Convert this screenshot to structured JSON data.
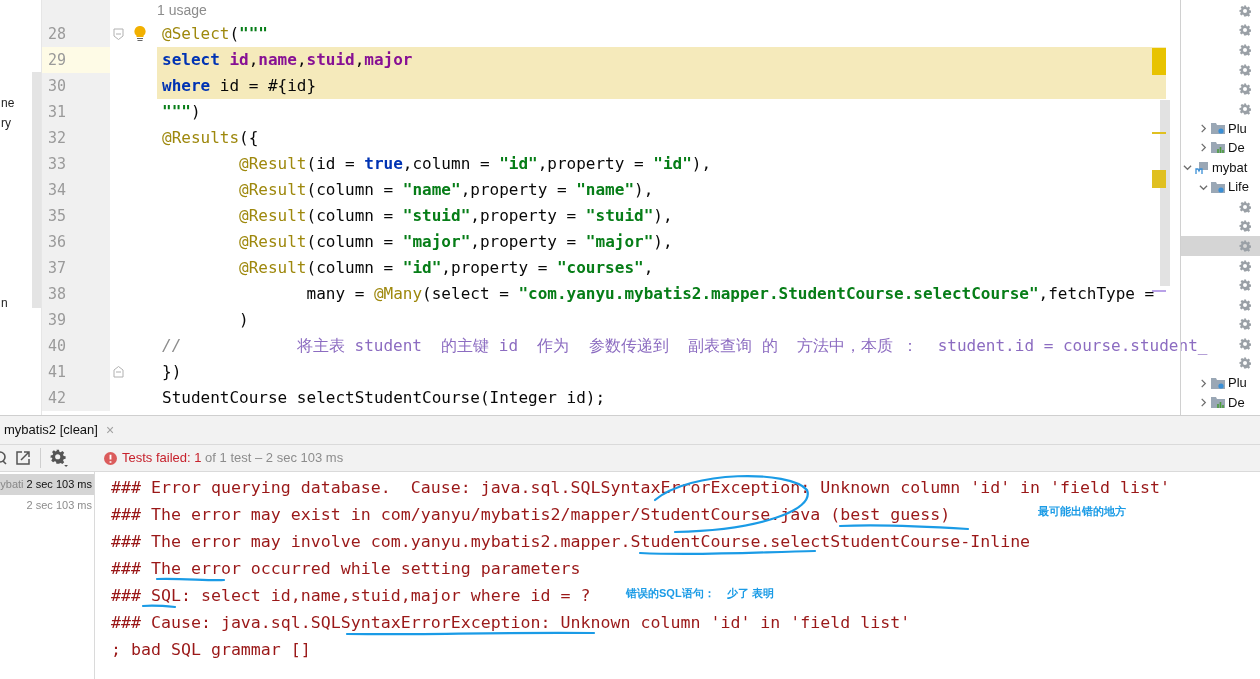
{
  "side_fragments": [
    {
      "text": "ne"
    },
    {
      "text": "ry"
    },
    {
      "text": "n"
    }
  ],
  "usage_hint": "1 usage",
  "code_lines": [
    {
      "number": "28",
      "highlighted": false,
      "current": false,
      "fold_start": true,
      "fold_end": false,
      "bulb": true,
      "tokens": [
        {
          "kind": "ann",
          "text": "@Select"
        },
        {
          "kind": "plain",
          "text": "("
        },
        {
          "kind": "str",
          "text": "\"\"\""
        }
      ]
    },
    {
      "number": "29",
      "highlighted": true,
      "current": true,
      "fold_start": false,
      "fold_end": false,
      "bulb": false,
      "tokens": [
        {
          "kind": "kw",
          "text": "select "
        },
        {
          "kind": "field",
          "text": "id"
        },
        {
          "kind": "plain",
          "text": ","
        },
        {
          "kind": "field",
          "text": "name"
        },
        {
          "kind": "plain",
          "text": ","
        },
        {
          "kind": "field",
          "text": "stuid"
        },
        {
          "kind": "plain",
          "text": ","
        },
        {
          "kind": "field",
          "text": "major"
        }
      ]
    },
    {
      "number": "30",
      "highlighted": true,
      "current": false,
      "fold_start": false,
      "fold_end": false,
      "bulb": false,
      "tokens": [
        {
          "kind": "kw",
          "text": "where"
        },
        {
          "kind": "plain",
          "text": " id = #{id}"
        }
      ]
    },
    {
      "number": "31",
      "highlighted": false,
      "current": false,
      "fold_start": false,
      "fold_end": false,
      "bulb": false,
      "tokens": [
        {
          "kind": "str",
          "text": "\"\"\""
        },
        {
          "kind": "plain",
          "text": ")"
        }
      ]
    },
    {
      "number": "32",
      "highlighted": false,
      "current": false,
      "fold_start": false,
      "fold_end": false,
      "bulb": false,
      "tokens": [
        {
          "kind": "ann",
          "text": "@Results"
        },
        {
          "kind": "plain",
          "text": "({"
        }
      ]
    },
    {
      "number": "33",
      "highlighted": false,
      "current": false,
      "fold_start": false,
      "fold_end": false,
      "bulb": false,
      "tokens": [
        {
          "kind": "ann",
          "text": "        @Result"
        },
        {
          "kind": "plain",
          "text": "(id = "
        },
        {
          "kind": "kw",
          "text": "true"
        },
        {
          "kind": "plain",
          "text": ",column = "
        },
        {
          "kind": "str",
          "text": "\"id\""
        },
        {
          "kind": "plain",
          "text": ",property = "
        },
        {
          "kind": "str",
          "text": "\"id\""
        },
        {
          "kind": "plain",
          "text": "),"
        }
      ]
    },
    {
      "number": "34",
      "highlighted": false,
      "current": false,
      "fold_start": false,
      "fold_end": false,
      "bulb": false,
      "tokens": [
        {
          "kind": "ann",
          "text": "        @Result"
        },
        {
          "kind": "plain",
          "text": "(column = "
        },
        {
          "kind": "str",
          "text": "\"name\""
        },
        {
          "kind": "plain",
          "text": ",property = "
        },
        {
          "kind": "str",
          "text": "\"name\""
        },
        {
          "kind": "plain",
          "text": "),"
        }
      ]
    },
    {
      "number": "35",
      "highlighted": false,
      "current": false,
      "fold_start": false,
      "fold_end": false,
      "bulb": false,
      "tokens": [
        {
          "kind": "ann",
          "text": "        @Result"
        },
        {
          "kind": "plain",
          "text": "(column = "
        },
        {
          "kind": "str",
          "text": "\"stuid\""
        },
        {
          "kind": "plain",
          "text": ",property = "
        },
        {
          "kind": "str",
          "text": "\"stuid\""
        },
        {
          "kind": "plain",
          "text": "),"
        }
      ]
    },
    {
      "number": "36",
      "highlighted": false,
      "current": false,
      "fold_start": false,
      "fold_end": false,
      "bulb": false,
      "tokens": [
        {
          "kind": "ann",
          "text": "        @Result"
        },
        {
          "kind": "plain",
          "text": "(column = "
        },
        {
          "kind": "str",
          "text": "\"major\""
        },
        {
          "kind": "plain",
          "text": ",property = "
        },
        {
          "kind": "str",
          "text": "\"major\""
        },
        {
          "kind": "plain",
          "text": "),"
        }
      ]
    },
    {
      "number": "37",
      "highlighted": false,
      "current": false,
      "fold_start": false,
      "fold_end": false,
      "bulb": false,
      "tokens": [
        {
          "kind": "ann",
          "text": "        @Result"
        },
        {
          "kind": "plain",
          "text": "(column = "
        },
        {
          "kind": "str",
          "text": "\"id\""
        },
        {
          "kind": "plain",
          "text": ",property = "
        },
        {
          "kind": "str",
          "text": "\"courses\""
        },
        {
          "kind": "plain",
          "text": ","
        }
      ]
    },
    {
      "number": "38",
      "highlighted": false,
      "current": false,
      "fold_start": false,
      "fold_end": false,
      "bulb": false,
      "tokens": [
        {
          "kind": "plain",
          "text": "               many = "
        },
        {
          "kind": "ann",
          "text": "@Many"
        },
        {
          "kind": "plain",
          "text": "(select = "
        },
        {
          "kind": "str",
          "text": "\"com.yanyu.mybatis2.mapper.StudentCourse.selectCourse\""
        },
        {
          "kind": "plain",
          "text": ",fetchType ="
        }
      ]
    },
    {
      "number": "39",
      "highlighted": false,
      "current": false,
      "fold_start": false,
      "fold_end": false,
      "bulb": false,
      "tokens": [
        {
          "kind": "plain",
          "text": "        )"
        }
      ]
    },
    {
      "number": "40",
      "highlighted": false,
      "current": false,
      "fold_start": false,
      "fold_end": false,
      "bulb": false,
      "tokens": [
        {
          "kind": "comment",
          "text": "//"
        },
        {
          "kind": "comment_text",
          "text": "            将主表 student  的主键 id  作为  参数传递到  副表查询 的  方法中，本质 ：  student.id = course.student_"
        }
      ]
    },
    {
      "number": "41",
      "highlighted": false,
      "current": false,
      "fold_start": false,
      "fold_end": true,
      "bulb": false,
      "tokens": [
        {
          "kind": "plain",
          "text": "})"
        }
      ]
    },
    {
      "number": "42",
      "highlighted": false,
      "current": false,
      "fold_start": false,
      "fold_end": false,
      "bulb": false,
      "tokens": [
        {
          "kind": "plain",
          "text": "StudentCourse selectStudentCourse(Integer id);"
        }
      ]
    }
  ],
  "maven_tree": [
    {
      "kind": "hidden",
      "children": [
        {
          "kind": "hidden",
          "children": [
            {
              "kind": "goal",
              "selected": false
            },
            {
              "kind": "goal",
              "selected": false
            },
            {
              "kind": "goal",
              "selected": false
            },
            {
              "kind": "goal",
              "selected": false
            },
            {
              "kind": "goal",
              "selected": false
            },
            {
              "kind": "goal",
              "selected": false
            }
          ]
        },
        {
          "kind": "plugins",
          "label": "Plu",
          "expanded": false
        },
        {
          "kind": "deps",
          "label": "De",
          "expanded": false
        }
      ]
    },
    {
      "kind": "module",
      "label": "mybat",
      "expanded": true,
      "children": [
        {
          "kind": "plugins",
          "label": "Life",
          "expanded": true,
          "children": [
            {
              "kind": "goal",
              "selected": false
            },
            {
              "kind": "goal",
              "selected": false
            },
            {
              "kind": "goal",
              "selected": true
            },
            {
              "kind": "goal",
              "selected": false
            },
            {
              "kind": "goal",
              "selected": false
            },
            {
              "kind": "goal",
              "selected": false
            },
            {
              "kind": "goal",
              "selected": false
            },
            {
              "kind": "goal",
              "selected": false
            },
            {
              "kind": "goal",
              "selected": false
            }
          ]
        },
        {
          "kind": "plugins",
          "label": "Plu",
          "expanded": false
        },
        {
          "kind": "deps",
          "label": "De",
          "expanded": false
        }
      ]
    }
  ],
  "run_tab": {
    "label": "mybatis2 [clean]",
    "close": "×"
  },
  "status": {
    "failed": "Tests failed: 1",
    "rest": " of 1 test – 2 sec 103 ms"
  },
  "test_list": [
    {
      "name": "ybati",
      "time": "2 sec 103 ms",
      "selected": true
    },
    {
      "time": "2 sec 103 ms",
      "selected": false
    }
  ],
  "console_lines": [
    "### Error querying database.  Cause: java.sql.SQLSyntaxErrorException: Unknown column 'id' in 'field list'",
    "### The error may exist in com/yanyu/mybatis2/mapper/StudentCourse.java (best guess)",
    "### The error may involve com.yanyu.mybatis2.mapper.StudentCourse.selectStudentCourse-Inline",
    "### The error occurred while setting parameters",
    "### SQL: select id,name,stuid,major where id = ?",
    "### Cause: java.sql.SQLSyntaxErrorException: Unknown column 'id' in 'field list'",
    "; bad SQL grammar []"
  ],
  "notes": [
    {
      "text": "最可能出错的地方"
    },
    {
      "text": "错误的SQL语句：    少了 表明"
    }
  ]
}
